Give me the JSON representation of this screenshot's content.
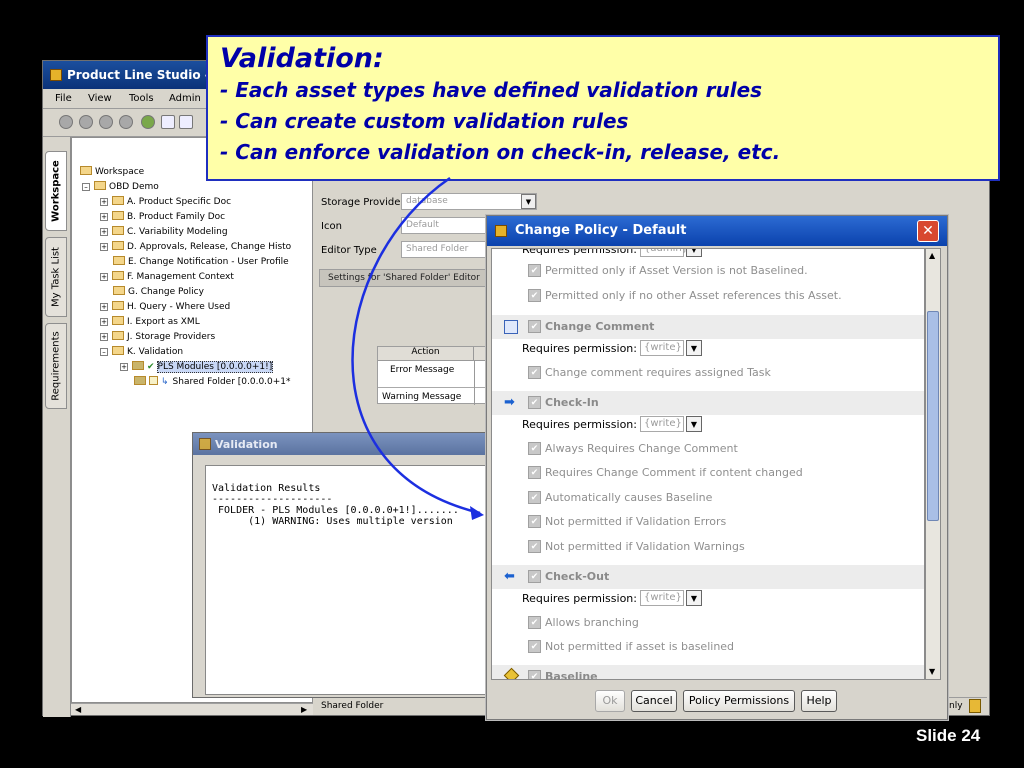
{
  "main_window": {
    "title": "Product Line Studio - M",
    "menus": [
      "File",
      "View",
      "Tools",
      "Admin"
    ],
    "side_tabs": [
      "Workspace",
      "My Task List",
      "Requirements"
    ],
    "tree": [
      "Workspace",
      "OBD Demo",
      "A. Product Specific Doc",
      "B. Product Family Doc",
      "C. Variability Modeling",
      "D. Approvals, Release, Change Histo",
      "E. Change Notification - User Profile",
      "F. Management Context",
      "G. Change Policy",
      "H. Query - Where Used",
      "I. Export as XML",
      "J. Storage Providers",
      "K. Validation",
      "PLS Modules [0.0.0.0+1!]",
      "Shared Folder [0.0.0.0+1*"
    ],
    "properties": {
      "storage_provider_label": "Storage Provider",
      "storage_provider_value": "database",
      "icon_label": "Icon",
      "icon_value": "Default",
      "editor_type_label": "Editor Type",
      "editor_type_value": "Shared Folder",
      "editor_tab": "Settings for 'Shared Folder' Editor",
      "grid_header": "Action",
      "grid_rows": [
        "Error Message",
        "Warning Message"
      ],
      "status_left": "Shared Folder",
      "status_right": "nly"
    }
  },
  "validation_window": {
    "title": "Validation",
    "lines": [
      "Validation Results",
      "--------------------",
      "",
      " FOLDER - PLS Modules [0.0.0.0+1!].......",
      "      (1) WARNING: Uses multiple version"
    ]
  },
  "change_policy": {
    "title": "Change Policy - Default",
    "close_glyph": "✕",
    "top_partial": "Requires permission:",
    "top_partial_value": "{admin}",
    "rows_top": [
      "Permitted only if Asset Version is not Baselined.",
      "Permitted only if no other Asset references this Asset."
    ],
    "sections": [
      {
        "name": "Change Comment",
        "permission_label": "Requires permission:",
        "permission_value": "{write}",
        "options": [
          "Change comment requires assigned Task"
        ]
      },
      {
        "name": "Check-In",
        "permission_label": "Requires permission:",
        "permission_value": "{write}",
        "options": [
          "Always Requires Change Comment",
          "Requires Change Comment if content changed",
          "Automatically causes Baseline",
          "Not permitted if Validation Errors",
          "Not permitted if Validation Warnings"
        ]
      },
      {
        "name": "Check-Out",
        "permission_label": "Requires permission:",
        "permission_value": "{write}",
        "options": [
          "Allows branching",
          "Not permitted if asset is baselined"
        ]
      },
      {
        "name": "Baseline",
        "permission_label": "",
        "permission_value": "",
        "options": []
      }
    ],
    "buttons": {
      "ok": "Ok",
      "cancel": "Cancel",
      "policy_permissions": "Policy Permissions",
      "help": "Help"
    }
  },
  "callout": {
    "title": "Validation:",
    "lines": [
      "- Each asset types have defined validation rules",
      "- Can create custom validation rules",
      "- Can enforce validation on check-in, release, etc."
    ],
    "border_color": "#1f2fbf",
    "background": "#ffffa8",
    "text_color": "#0000a8"
  },
  "slide_label": "Slide 24"
}
